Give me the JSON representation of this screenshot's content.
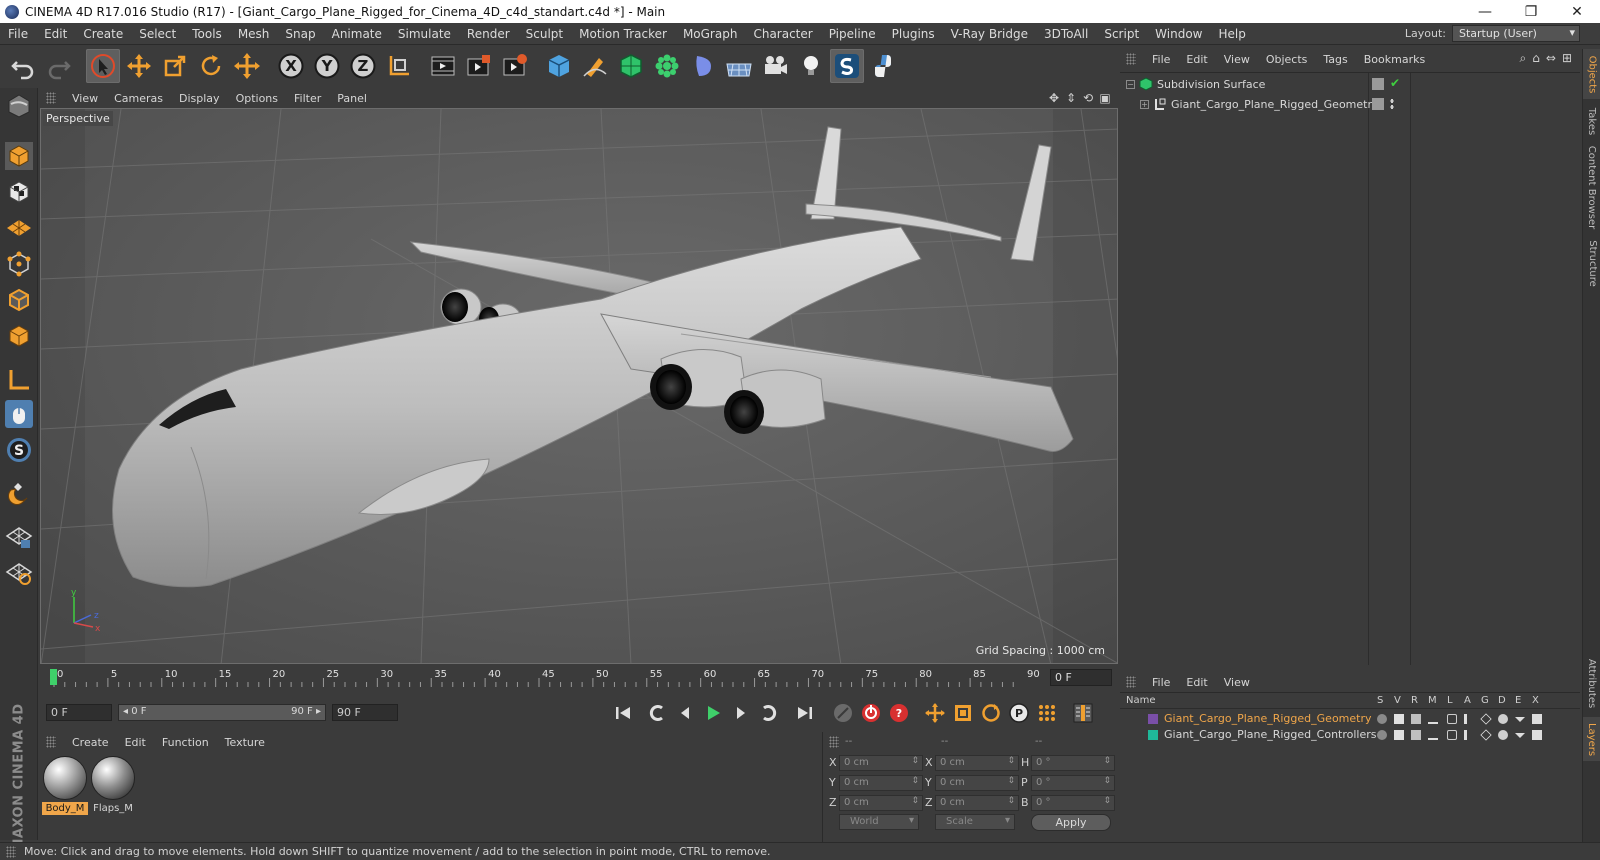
{
  "window": {
    "title": "CINEMA 4D R17.016 Studio (R17) - [Giant_Cargo_Plane_Rigged_for_Cinema_4D_c4d_standart.c4d *] - Main",
    "minimize": "—",
    "maximize": "❐",
    "close": "✕"
  },
  "menu": {
    "items": [
      "File",
      "Edit",
      "Create",
      "Select",
      "Tools",
      "Mesh",
      "Snap",
      "Animate",
      "Simulate",
      "Render",
      "Sculpt",
      "Motion Tracker",
      "MoGraph",
      "Character",
      "Pipeline",
      "Plugins",
      "V-Ray Bridge",
      "3DToAll",
      "Script",
      "Window",
      "Help"
    ],
    "layout_label": "Layout:",
    "layout_value": "Startup (User)"
  },
  "toolbar": {
    "icons": [
      "undo-icon",
      "redo-icon",
      "live-selection-icon",
      "move-icon",
      "scale-icon",
      "rotate-icon",
      "last-tool-icon",
      "x-axis-icon",
      "y-axis-icon",
      "z-axis-icon",
      "world-coordinates-icon",
      "render-view-icon",
      "render-picture-viewer-icon",
      "edit-render-settings-icon",
      "cube-icon",
      "pen-icon",
      "subdivision-icon",
      "cloner-icon",
      "deformer-icon",
      "floor-icon",
      "camera-icon",
      "light-icon",
      "sculpt-icon",
      "python-icon"
    ]
  },
  "viewport": {
    "menus": [
      "View",
      "Cameras",
      "Display",
      "Options",
      "Filter",
      "Panel"
    ],
    "label": "Perspective",
    "grid_spacing": "Grid Spacing : 1000 cm"
  },
  "timeline": {
    "ticks": [
      "0",
      "5",
      "10",
      "15",
      "20",
      "25",
      "30",
      "35",
      "40",
      "45",
      "50",
      "55",
      "60",
      "65",
      "70",
      "75",
      "80",
      "85",
      "90"
    ],
    "current_frame": "0 F"
  },
  "transport": {
    "start_frame": "0 F",
    "range_start": "◂ 0 F",
    "range_end": "90 F ▸",
    "end_frame": "90 F"
  },
  "materials": {
    "menus": [
      "Create",
      "Edit",
      "Function",
      "Texture"
    ],
    "items": [
      {
        "name": "Body_M",
        "selected": true
      },
      {
        "name": "Flaps_M",
        "selected": false
      }
    ]
  },
  "coordinates": {
    "headers": [
      "--",
      "--",
      "--"
    ],
    "rows": [
      {
        "a": "X",
        "av": "0 cm",
        "b": "X",
        "bv": "0 cm",
        "c": "H",
        "cv": "0 °"
      },
      {
        "a": "Y",
        "av": "0 cm",
        "b": "Y",
        "bv": "0 cm",
        "c": "P",
        "cv": "0 °"
      },
      {
        "a": "Z",
        "av": "0 cm",
        "b": "Z",
        "bv": "0 cm",
        "c": "B",
        "cv": "0 °"
      }
    ],
    "mode_world": "World",
    "mode_scale": "Scale",
    "apply": "Apply"
  },
  "status": {
    "text": "Move: Click and drag to move elements. Hold down SHIFT to quantize movement / add to the selection in point mode, CTRL to remove."
  },
  "object_manager": {
    "menus": [
      "File",
      "Edit",
      "View",
      "Objects",
      "Tags",
      "Bookmarks"
    ],
    "objects": [
      {
        "name": "Subdivision Surface",
        "indent": 0
      },
      {
        "name": "Giant_Cargo_Plane_Rigged_Geometry",
        "indent": 1
      }
    ]
  },
  "layer_manager": {
    "menus": [
      "File",
      "Edit",
      "View"
    ],
    "columns": [
      "Name",
      "S",
      "V",
      "R",
      "M",
      "L",
      "A",
      "G",
      "D",
      "E",
      "X"
    ],
    "layers": [
      {
        "name": "Giant_Cargo_Plane_Rigged_Geometry",
        "color": "#7a4fa8",
        "text_color": "#f0a64a"
      },
      {
        "name": "Giant_Cargo_Plane_Rigged_Controllers",
        "color": "#1fb89a",
        "text_color": "#d8d8d8"
      }
    ]
  },
  "side_tabs": [
    "Objects",
    "Takes",
    "Content Browser",
    "Structure",
    "Attributes",
    "Layers"
  ],
  "brand": "MAXON CINEMA 4D",
  "colors": {
    "accent": "#f0a64a",
    "selected_tool": "#5f5f5f"
  }
}
